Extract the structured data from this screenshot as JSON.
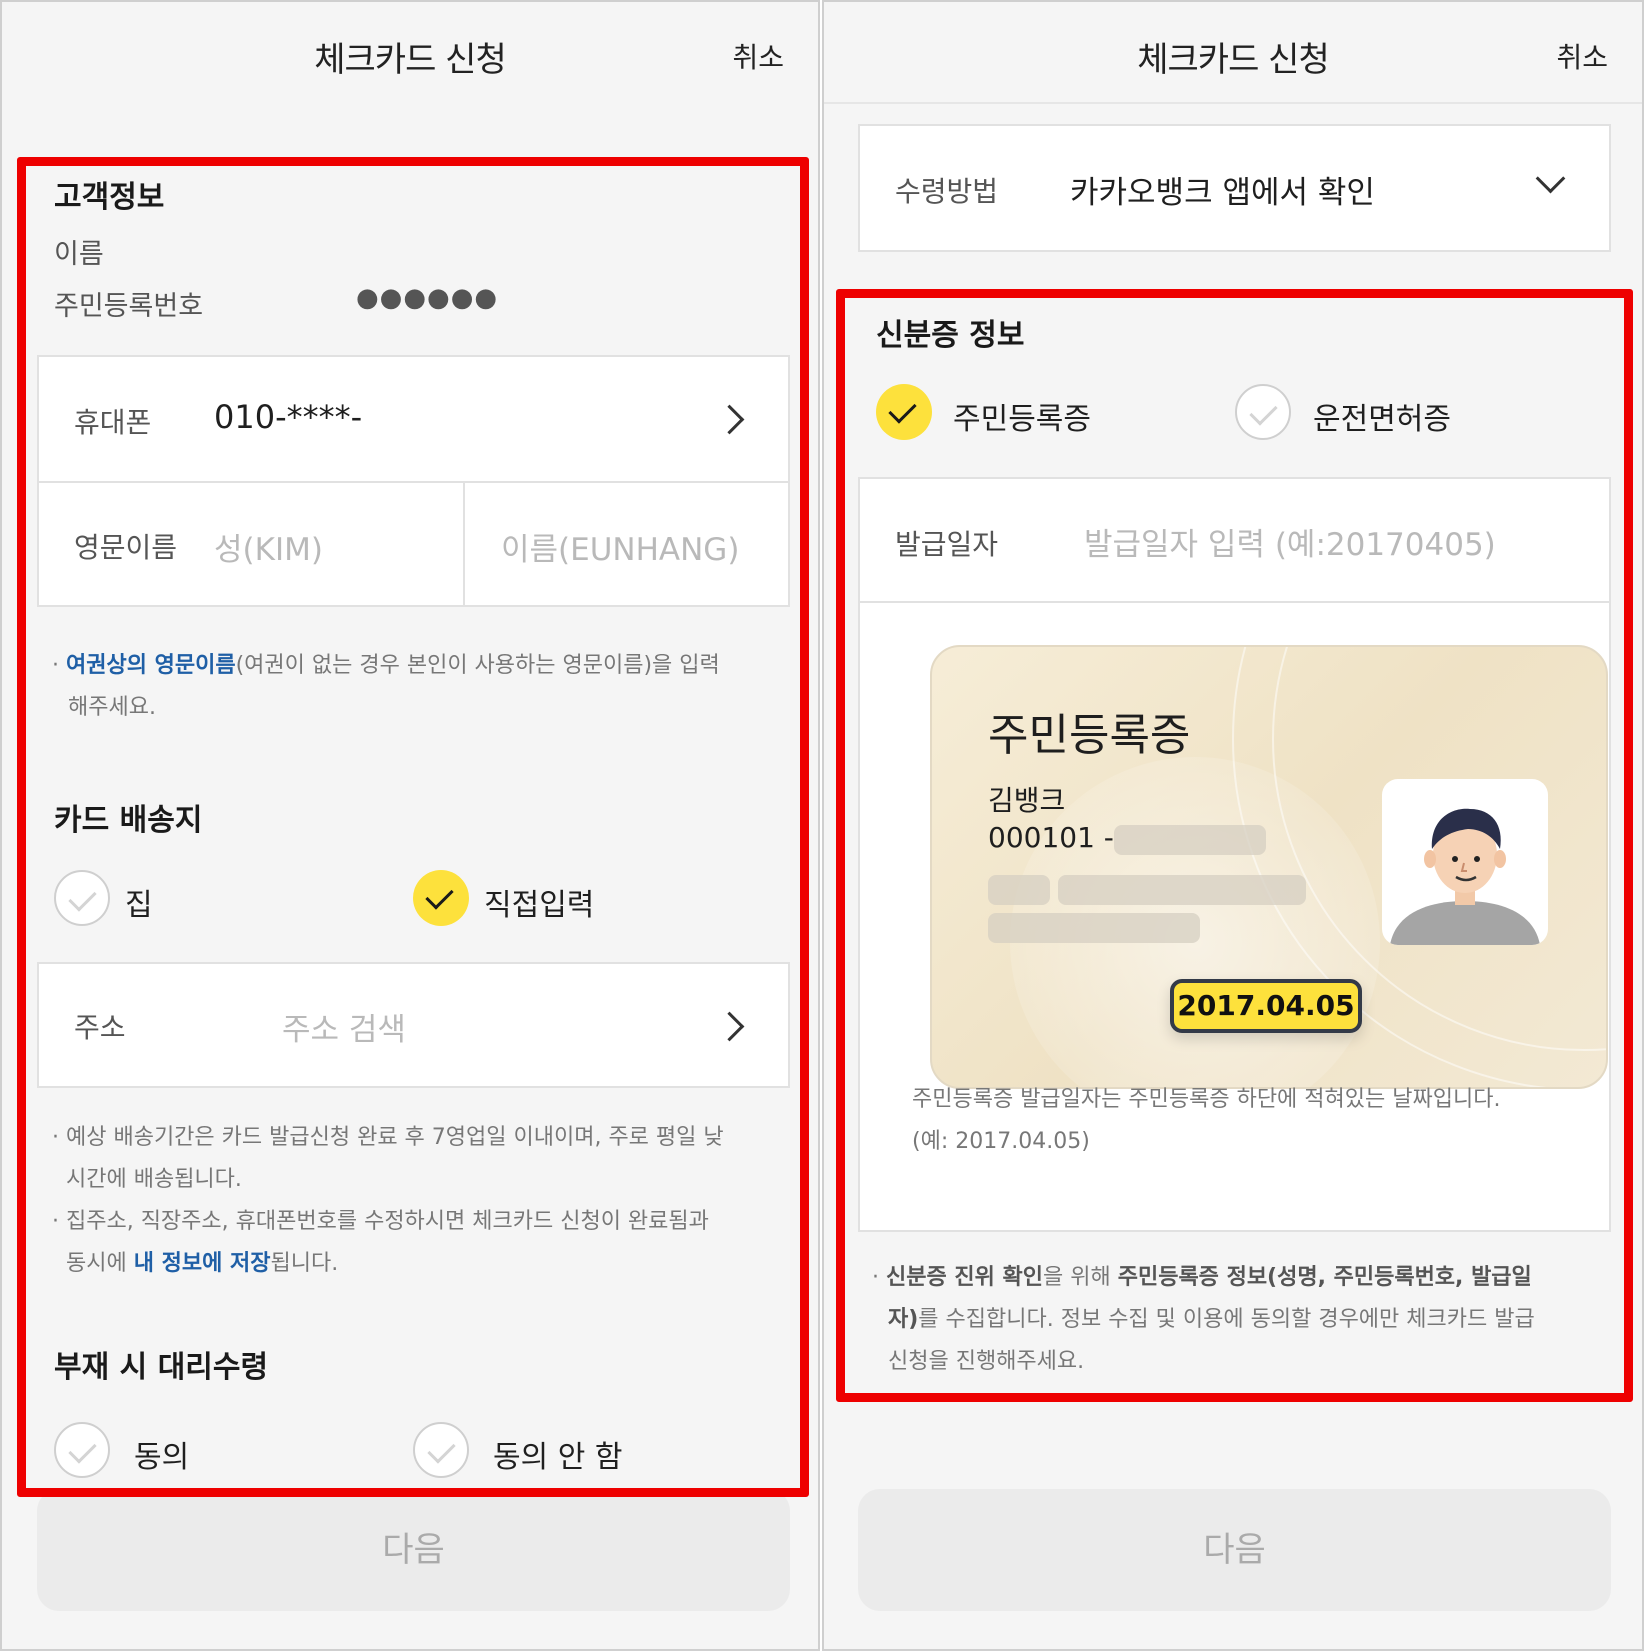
{
  "header": {
    "title": "체크카드 신청",
    "cancel_label": "취소"
  },
  "left": {
    "customer": {
      "section_title": "고객정보",
      "name_label": "이름",
      "rrn_label": "주민등록번호",
      "rrn_mask": "●●●●●●"
    },
    "phone": {
      "label": "휴대폰",
      "value": "010-****-"
    },
    "english_name": {
      "label": "영문이름",
      "last_placeholder": "성(KIM)",
      "first_placeholder": "이름(EUNHANG)"
    },
    "english_note": {
      "bullet": "·",
      "highlight": "여권상의 영문이름",
      "text_line1": "(여권이 없는 경우 본인이 사용하는 영문이름)을 입력",
      "text_line2": "해주세요."
    },
    "delivery": {
      "section_title": "카드 배송지",
      "option_home": "집",
      "option_direct": "직접입력",
      "selected": "직접입력"
    },
    "address": {
      "label": "주소",
      "placeholder": "주소 검색"
    },
    "delivery_notes": {
      "note1_line1": "· 예상 배송기간은 카드 발급신청 완료 후 7영업일 이내이며, 주로 평일 낮",
      "note1_line2": "시간에 배송됩니다.",
      "note2_line1": "· 집주소, 직장주소, 휴대폰번호를 수정하시면 체크카드 신청이 완료됨과",
      "note2_prefix": "동시에 ",
      "note2_highlight": "내 정보에 저장",
      "note2_suffix": "됩니다."
    },
    "proxy": {
      "section_title": "부재 시 대리수령",
      "option_agree": "동의",
      "option_disagree": "동의 안 함"
    },
    "next_label": "다음"
  },
  "right": {
    "receive": {
      "label": "수령방법",
      "value": "카카오뱅크 앱에서 확인"
    },
    "id_info": {
      "section_title": "신분증 정보",
      "option_rrn_card": "주민등록증",
      "option_license": "운전면허증",
      "selected": "주민등록증"
    },
    "issue_date": {
      "label": "발급일자",
      "placeholder": "발급일자 입력 (예:20170405)"
    },
    "id_card_sample": {
      "title": "주민등록증",
      "name": "김뱅크",
      "number": "000101 -",
      "date": "2017.04.05"
    },
    "issue_note": {
      "line1": "주민등록증 발급일자는 주민등록증 하단에 적혀있는 날짜입니다.",
      "line2": "(예: 2017.04.05)"
    },
    "privacy_note": {
      "bullet": "·",
      "bold1": "신분증 진위 확인",
      "text1": "을 위해 ",
      "bold2": "주민등록증 정보(성명, 주민등록번호, 발급일",
      "bold3": "자)",
      "text2": "를 수집합니다. 정보 수집 및 이용에 동의할 경우에만 체크카드 발급",
      "line3": "신청을 진행해주세요."
    },
    "next_label": "다음"
  },
  "colors": {
    "accent_yellow": "#fde13c",
    "highlight_red": "#ee0000",
    "link_blue": "#1f5fa6"
  }
}
